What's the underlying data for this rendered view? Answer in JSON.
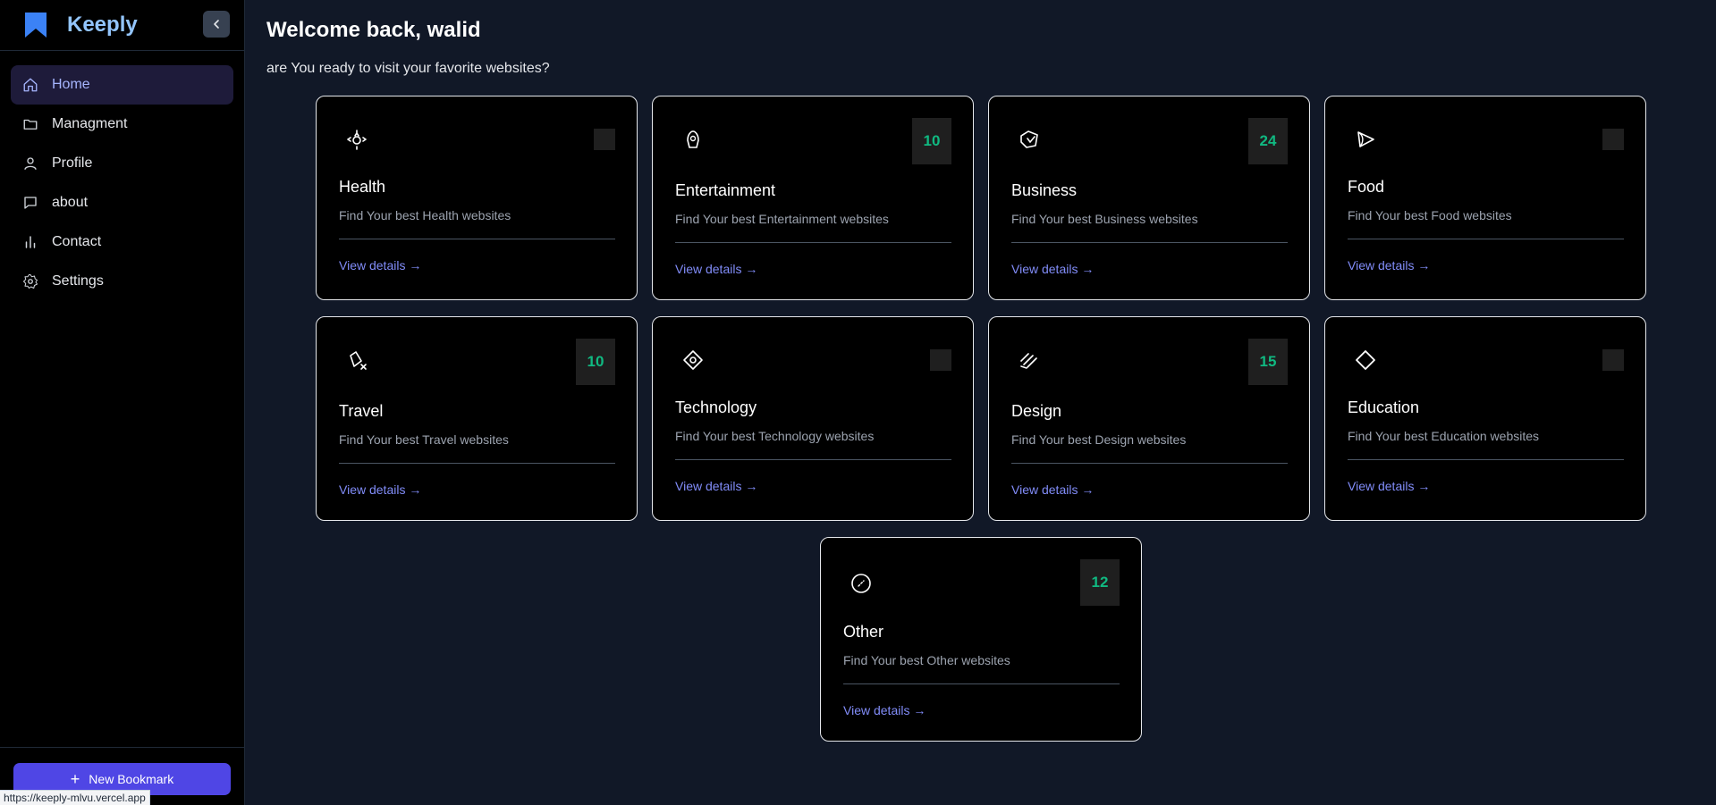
{
  "app": {
    "name": "Keeply"
  },
  "sidebar": {
    "items": [
      {
        "label": "Home",
        "icon": "home-icon",
        "active": true
      },
      {
        "label": "Managment",
        "icon": "folder-icon",
        "active": false
      },
      {
        "label": "Profile",
        "icon": "user-icon",
        "active": false
      },
      {
        "label": "about",
        "icon": "chat-icon",
        "active": false
      },
      {
        "label": "Contact",
        "icon": "bar-chart-icon",
        "active": false
      },
      {
        "label": "Settings",
        "icon": "gear-icon",
        "active": false
      }
    ],
    "new_bookmark_label": "New Bookmark"
  },
  "status_bar": {
    "url": "https://keeply-mlvu.vercel.app"
  },
  "main": {
    "title": "Welcome back, walid",
    "subtitle": "are You ready to visit your favorite websites?"
  },
  "categories": [
    {
      "title": "Health",
      "description": "Find Your best Health websites",
      "count": "",
      "link": "View details →",
      "icon": "health-icon"
    },
    {
      "title": "Entertainment",
      "description": "Find Your best Entertainment websites",
      "count": "10",
      "link": "View details →",
      "icon": "entertainment-icon"
    },
    {
      "title": "Business",
      "description": "Find Your best Business websites",
      "count": "24",
      "link": "View details →",
      "icon": "business-icon"
    },
    {
      "title": "Food",
      "description": "Find Your best Food websites",
      "count": "",
      "link": "View details →",
      "icon": "food-icon"
    },
    {
      "title": "Travel",
      "description": "Find Your best Travel websites",
      "count": "10",
      "link": "View details →",
      "icon": "travel-icon"
    },
    {
      "title": "Technology",
      "description": "Find Your best Technology websites",
      "count": "",
      "link": "View details →",
      "icon": "technology-icon"
    },
    {
      "title": "Design",
      "description": "Find Your best Design websites",
      "count": "15",
      "link": "View details →",
      "icon": "design-icon"
    },
    {
      "title": "Education",
      "description": "Find Your best Education websites",
      "count": "",
      "link": "View details →",
      "icon": "education-icon"
    },
    {
      "title": "Other",
      "description": "Find Your best Other websites",
      "count": "12",
      "link": "View details →",
      "icon": "other-icon"
    }
  ],
  "colors": {
    "accent": "#4f46e5",
    "count_text": "#10b981",
    "link": "#818cf8",
    "brand": "#93c5fd"
  }
}
